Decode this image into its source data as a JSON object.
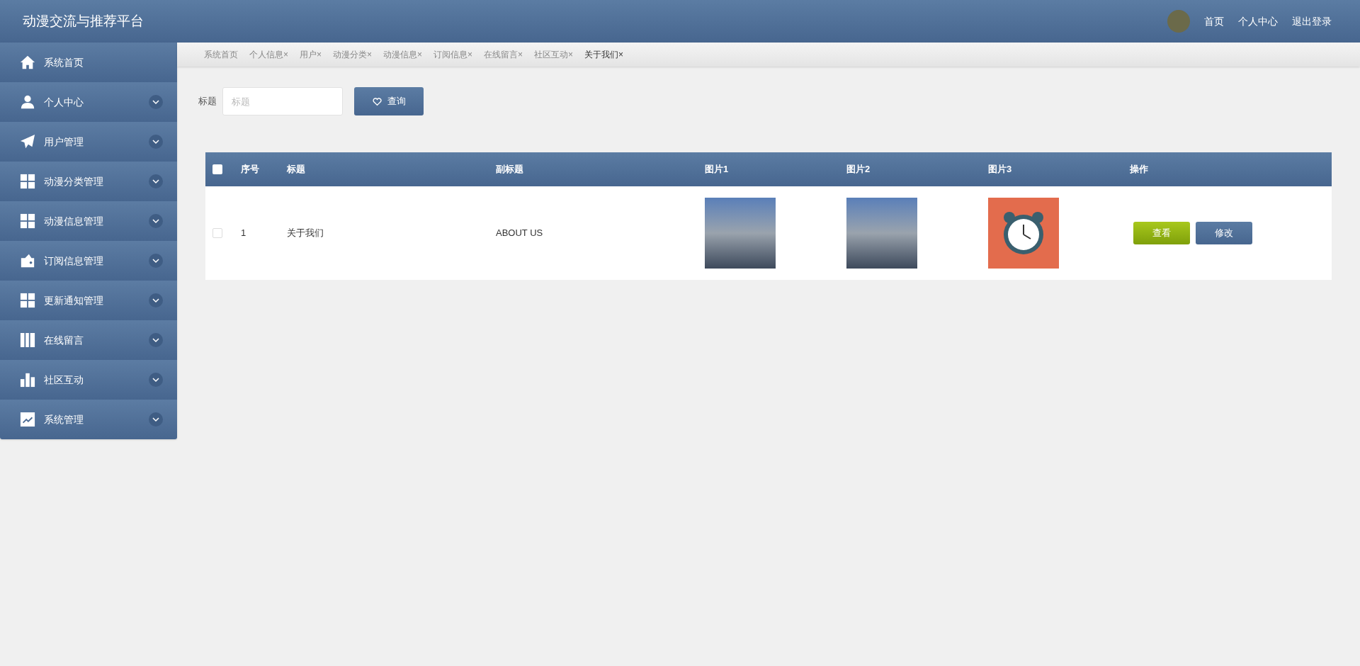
{
  "header": {
    "title": "动漫交流与推荐平台",
    "nav": [
      "首页",
      "个人中心",
      "退出登录"
    ]
  },
  "sidebar": {
    "items": [
      {
        "label": "系统首页",
        "expandable": false
      },
      {
        "label": "个人中心",
        "expandable": true
      },
      {
        "label": "用户管理",
        "expandable": true
      },
      {
        "label": "动漫分类管理",
        "expandable": true
      },
      {
        "label": "动漫信息管理",
        "expandable": true
      },
      {
        "label": "订阅信息管理",
        "expandable": true
      },
      {
        "label": "更新通知管理",
        "expandable": true
      },
      {
        "label": "在线留言",
        "expandable": true
      },
      {
        "label": "社区互动",
        "expandable": true
      },
      {
        "label": "系统管理",
        "expandable": true
      }
    ]
  },
  "tabs": [
    {
      "label": "系统首页",
      "closable": false,
      "selected": false
    },
    {
      "label": "个人信息",
      "closable": true,
      "selected": false
    },
    {
      "label": "用户",
      "closable": true,
      "selected": false
    },
    {
      "label": "动漫分类",
      "closable": true,
      "selected": false
    },
    {
      "label": "动漫信息",
      "closable": true,
      "selected": false
    },
    {
      "label": "订阅信息",
      "closable": true,
      "selected": false
    },
    {
      "label": "在线留言",
      "closable": true,
      "selected": false
    },
    {
      "label": "社区互动",
      "closable": true,
      "selected": false
    },
    {
      "label": "关于我们",
      "closable": true,
      "selected": true
    }
  ],
  "close_glyph": "×",
  "search": {
    "label": "标题",
    "placeholder": "标题",
    "button": "查询"
  },
  "table": {
    "columns": [
      "序号",
      "标题",
      "副标题",
      "图片1",
      "图片2",
      "图片3",
      "操作"
    ],
    "all_checked": false,
    "rows": [
      {
        "checked": false,
        "index": "1",
        "title": "关于我们",
        "subtitle": "ABOUT US",
        "images": [
          {
            "kind": "photo"
          },
          {
            "kind": "photo"
          },
          {
            "kind": "clock"
          }
        ],
        "actions": [
          "查看",
          "修改"
        ]
      }
    ]
  }
}
